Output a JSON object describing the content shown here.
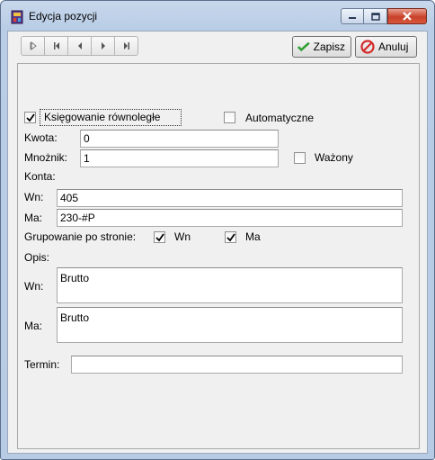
{
  "window": {
    "title": "Edycja pozycji"
  },
  "icons": {
    "app": "ledger-app-icon",
    "minimize": "minimize-icon",
    "maximize": "maximize-icon",
    "close": "close-icon",
    "nav": [
      "go-first-hollow-icon",
      "go-first-icon",
      "go-previous-icon",
      "go-next-icon",
      "go-last-icon"
    ],
    "save": "green-checkmark-icon",
    "cancel": "red-cancel-icon"
  },
  "toolbar": {
    "save_label": "Zapisz",
    "cancel_label": "Anuluj"
  },
  "form": {
    "parallel_booking": {
      "label": "Księgowanie równoległe",
      "checked": true
    },
    "automatic": {
      "label": "Automatyczne",
      "checked": false
    },
    "amount": {
      "label": "Kwota:",
      "value": "0"
    },
    "multiplier": {
      "label": "Mnożnik:",
      "value": "1"
    },
    "weighted": {
      "label": "Ważony",
      "checked": false
    },
    "accounts_header": "Konta:",
    "account_wn": {
      "label": "Wn:",
      "value": "405"
    },
    "account_ma": {
      "label": "Ma:",
      "value": "230-#P"
    },
    "grouping": {
      "label": "Grupowanie po stronie:",
      "wn": {
        "label": "Wn",
        "checked": true
      },
      "ma": {
        "label": "Ma",
        "checked": true
      }
    },
    "description_header": "Opis:",
    "desc_wn": {
      "label": "Wn:",
      "value": "Brutto"
    },
    "desc_ma": {
      "label": "Ma:",
      "value": "Brutto"
    },
    "deadline": {
      "label": "Termin:",
      "value": ""
    }
  },
  "colors": {
    "check_mark": "#000000",
    "save_icon": "#2e9e2e",
    "cancel_icon": "#d42a2a"
  }
}
